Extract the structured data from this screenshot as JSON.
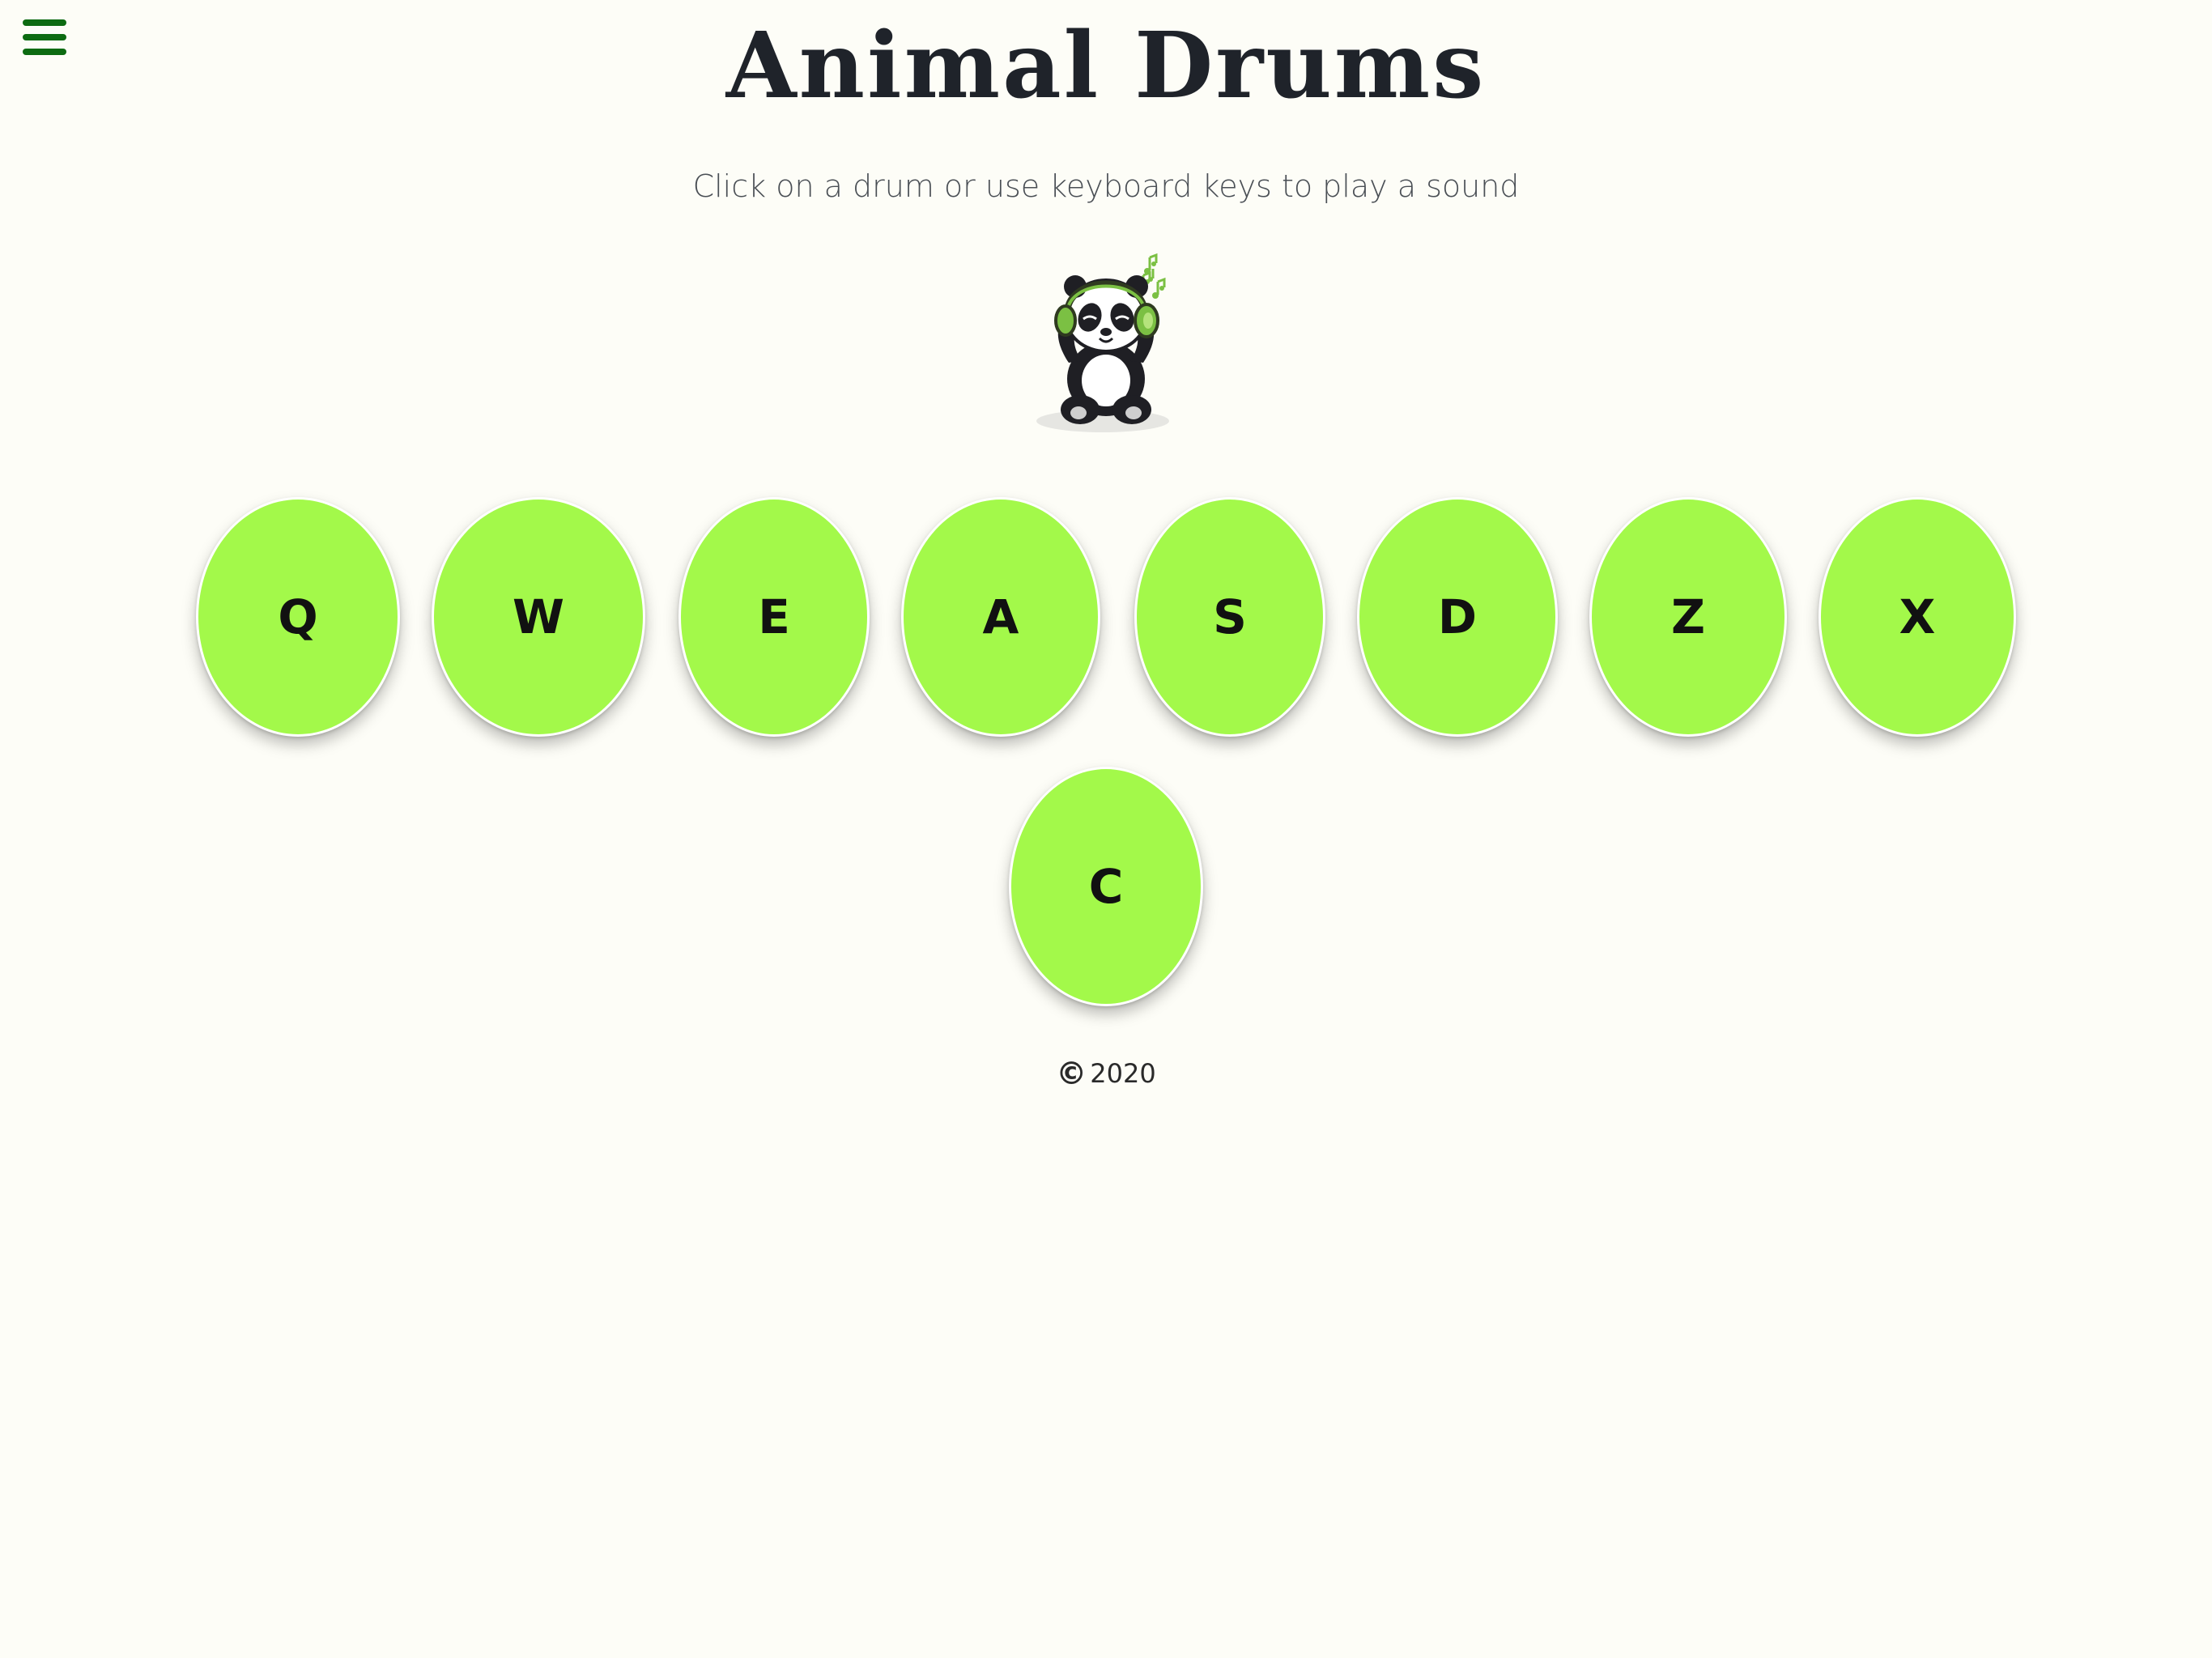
{
  "header": {
    "menu_icon": "hamburger-menu-icon",
    "title": "Animal Drums",
    "subtitle": "Click on a drum or use keyboard keys to play a sound"
  },
  "mascot": {
    "description_icon": "panda-headphones-icon"
  },
  "drums": [
    {
      "key": "Q"
    },
    {
      "key": "W"
    },
    {
      "key": "E"
    },
    {
      "key": "A"
    },
    {
      "key": "S"
    },
    {
      "key": "D"
    },
    {
      "key": "Z"
    },
    {
      "key": "X"
    },
    {
      "key": "C"
    }
  ],
  "footer": {
    "copyright_symbol": "©",
    "year": "2020"
  },
  "colors": {
    "background": "#fdfdf7",
    "drum": "#a3f94a",
    "menu": "#0d6b12",
    "title": "#1f232a"
  }
}
